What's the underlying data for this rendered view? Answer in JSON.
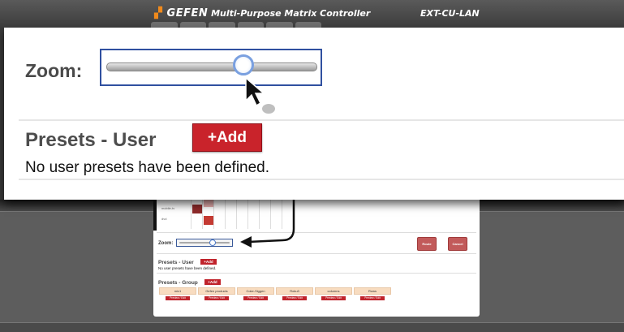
{
  "header": {
    "logo_text": "GEFEN",
    "app_title": "Multi-Purpose Matrix Controller",
    "model": "EXT-CU-LAN"
  },
  "zoom": {
    "label": "Zoom:",
    "slider_value": 0.68
  },
  "presets_user": {
    "title": "Presets - User",
    "add_label": "+Add",
    "empty_message": "No user presets have been defined."
  },
  "thumbnail": {
    "zoom_label": "Zoom:",
    "route_label": "Route",
    "cancel_label": "Cancel",
    "presets_user_title": "Presets - User",
    "presets_user_add": "+Add",
    "presets_user_empty": "No user presets have been defined.",
    "presets_group_title": "Presets - Group",
    "presets_group_add": "+Add",
    "grid_rows": [
      "mobile-tv",
      "dvd"
    ],
    "groups": [
      {
        "name": "mix1",
        "action": "Preview / Edit"
      },
      {
        "name": "Gefen products",
        "action": "Preview / Edit"
      },
      {
        "name": "Coke-Siggen",
        "action": "Preview / Edit"
      },
      {
        "name": "Roku3",
        "action": "Preview / Edit"
      },
      {
        "name": "columns",
        "action": "Preview / Edit"
      },
      {
        "name": "Rows",
        "action": "Preview / Edit"
      }
    ]
  },
  "colors": {
    "brand_orange": "#f08a1c",
    "add_red": "#c9232b",
    "focus_blue": "#3050a0"
  }
}
